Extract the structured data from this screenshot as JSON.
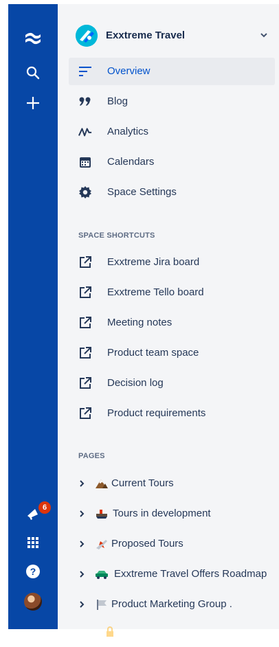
{
  "space": {
    "name": "Exxtreme Travel"
  },
  "main_nav": [
    {
      "label": "Overview",
      "icon": "overview-lines-icon",
      "active": true
    },
    {
      "label": "Blog",
      "icon": "quote-icon"
    },
    {
      "label": "Analytics",
      "icon": "analytics-icon"
    },
    {
      "label": "Calendars",
      "icon": "calendar-icon"
    },
    {
      "label": "Space Settings",
      "icon": "gear-icon"
    }
  ],
  "shortcuts": {
    "title": "SPACE SHORTCUTS",
    "items": [
      {
        "label": "Exxtreme Jira board"
      },
      {
        "label": "Exxtreme Tello board"
      },
      {
        "label": "Meeting notes"
      },
      {
        "label": "Product team space"
      },
      {
        "label": "Decision log"
      },
      {
        "label": "Product requirements"
      }
    ]
  },
  "pages": {
    "title": "PAGES",
    "items": [
      {
        "label": "Current Tours",
        "icon": "mountain-emoji-icon"
      },
      {
        "label": "Tours in development",
        "icon": "ship-emoji-icon"
      },
      {
        "label": "Proposed Tours",
        "icon": "airplane-emoji-icon"
      },
      {
        "label": "Exxtreme Travel Offers Roadmap",
        "icon": "car-emoji-icon"
      },
      {
        "label": "Product Marketing Group .",
        "icon": "flag-emoji-icon"
      }
    ]
  },
  "global_nav": {
    "notification_count": "6"
  },
  "colors": {
    "global_nav_bg": "#0747a6",
    "sidebar_bg": "#f4f5f7",
    "active_text": "#0052cc",
    "badge": "#de350b"
  }
}
